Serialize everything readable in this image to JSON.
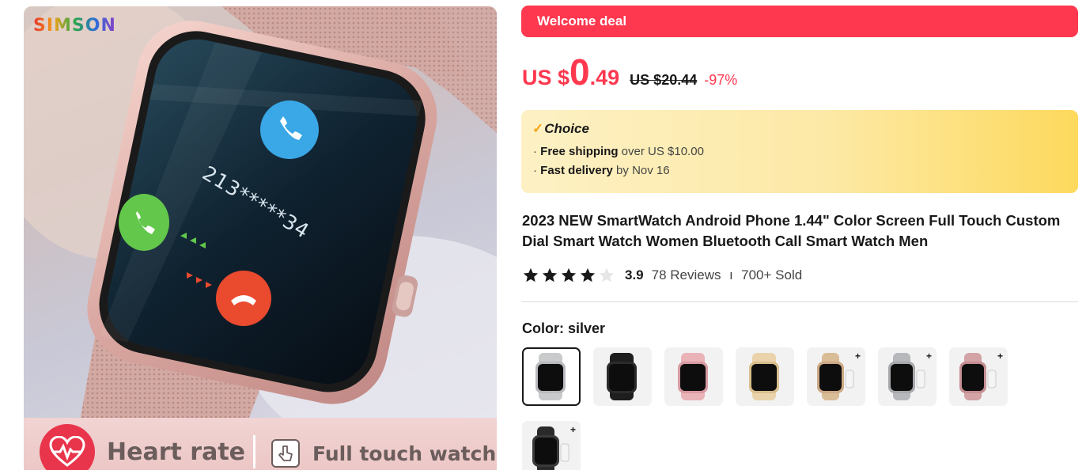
{
  "hero": {
    "brand": "SIMSON",
    "screen_number": "213*****34",
    "banner_left": "Heart rate",
    "banner_right": "Full touch watch",
    "icons": [
      "heart-rate-icon",
      "touch-hand-icon",
      "phone-call-icon",
      "accept-call-icon",
      "decline-call-icon"
    ]
  },
  "deal": {
    "label": "Welcome deal"
  },
  "price": {
    "currency": "US $",
    "integer": "0",
    "decimal": ".49",
    "original": "US $20.44",
    "discount": "-97%"
  },
  "choice": {
    "title": "Choice",
    "shipping_bold": "Free shipping",
    "shipping_rest": " over US $10.00",
    "delivery_bold": "Fast delivery",
    "delivery_rest": " by Nov 16"
  },
  "product": {
    "title": "2023 NEW SmartWatch Android Phone 1.44\" Color Screen Full Touch Custom Dial Smart Watch Women Bluetooth Call Smart Watch Men"
  },
  "rating": {
    "stars_filled": 4,
    "stars_total": 5,
    "value": "3.9",
    "reviews": "78 Reviews",
    "separator": "I",
    "sold": "700+ Sold"
  },
  "color": {
    "label": "Color: silver",
    "options": [
      {
        "name": "silver",
        "band": "#c9cacc",
        "case": "#b8babd",
        "selected": true
      },
      {
        "name": "black",
        "band": "#1e1e1e",
        "case": "#2b2b2b",
        "selected": false
      },
      {
        "name": "pink",
        "band": "#eab3b8",
        "case": "#d89aa2",
        "selected": false
      },
      {
        "name": "gold",
        "band": "#ead3ab",
        "case": "#d8bd8c",
        "selected": false
      },
      {
        "name": "gold mesh set",
        "band": "#d9bd97",
        "case": "#cda985",
        "selected": false
      },
      {
        "name": "silver mesh set",
        "band": "#b6b8bb",
        "case": "#a6a8ab",
        "selected": false
      },
      {
        "name": "pink mesh set",
        "band": "#d3a3a5",
        "case": "#c48e93",
        "selected": false
      },
      {
        "name": "black mesh set",
        "band": "#2a2a2a",
        "case": "#3a3a3a",
        "selected": false
      }
    ]
  }
}
